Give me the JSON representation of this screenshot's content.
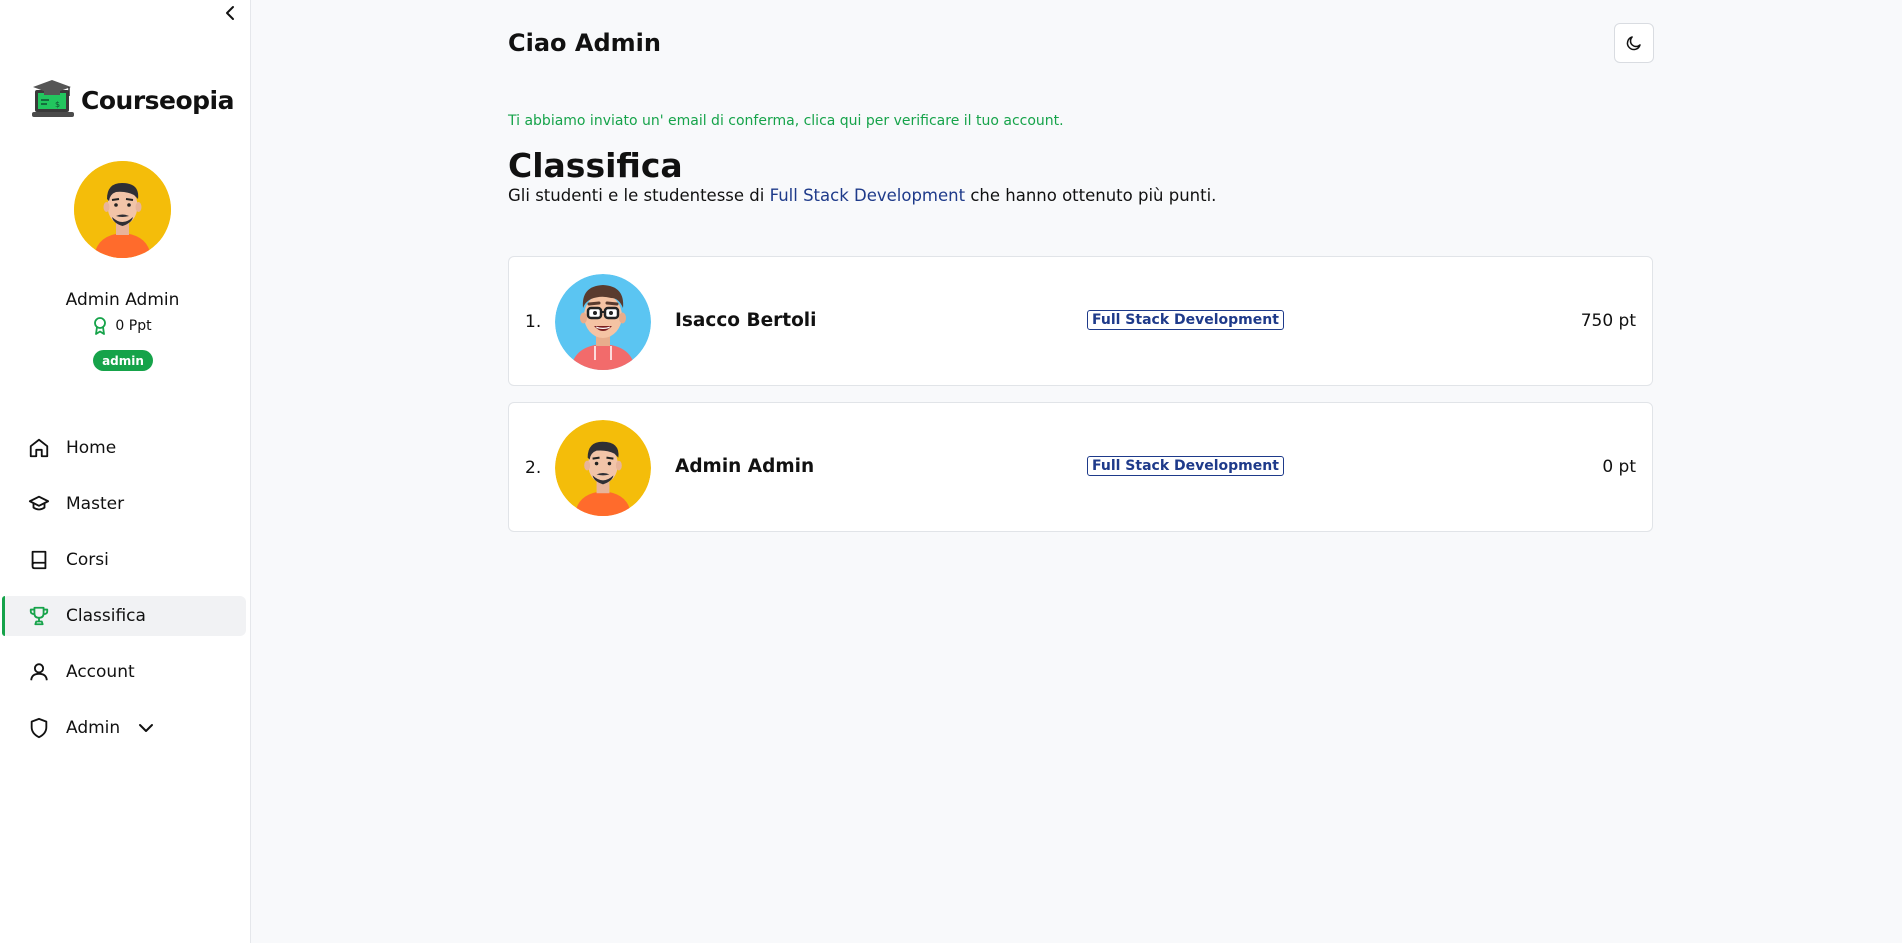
{
  "sidebar": {
    "collapse_icon": "chevron-left-icon",
    "brand": "Courseopia",
    "user": {
      "name": "Admin Admin",
      "points": "0 Ppt",
      "role": "admin"
    },
    "nav": [
      {
        "label": "Home",
        "icon": "home-icon",
        "active": false
      },
      {
        "label": "Master",
        "icon": "graduation-cap-icon",
        "active": false
      },
      {
        "label": "Corsi",
        "icon": "book-icon",
        "active": false
      },
      {
        "label": "Classifica",
        "icon": "trophy-icon",
        "active": true
      },
      {
        "label": "Account",
        "icon": "user-icon",
        "active": false
      },
      {
        "label": "Admin",
        "icon": "shield-icon",
        "active": false,
        "expandable": true
      }
    ]
  },
  "header": {
    "greeting": "Ciao Admin",
    "theme_toggle_icon": "moon-icon"
  },
  "notice": "Ti abbiamo inviato un' email di conferma, clica qui per verificare il tuo account.",
  "page": {
    "title": "Classifica",
    "subtitle_prefix": "Gli studenti e le studentesse di ",
    "subtitle_link": "Full Stack Development",
    "subtitle_suffix": " che hanno ottenuto più punti."
  },
  "leaderboard": [
    {
      "rank": "1.",
      "name": "Isacco Bertoli",
      "course": "Full Stack Development",
      "points": "750 pt"
    },
    {
      "rank": "2.",
      "name": "Admin Admin",
      "course": "Full Stack Development",
      "points": "0 pt"
    }
  ],
  "colors": {
    "accent": "#16a34a",
    "link": "#1e3a8a",
    "avatar_yellow": "#f4bd0a",
    "avatar_blue": "#5bc5f2"
  }
}
